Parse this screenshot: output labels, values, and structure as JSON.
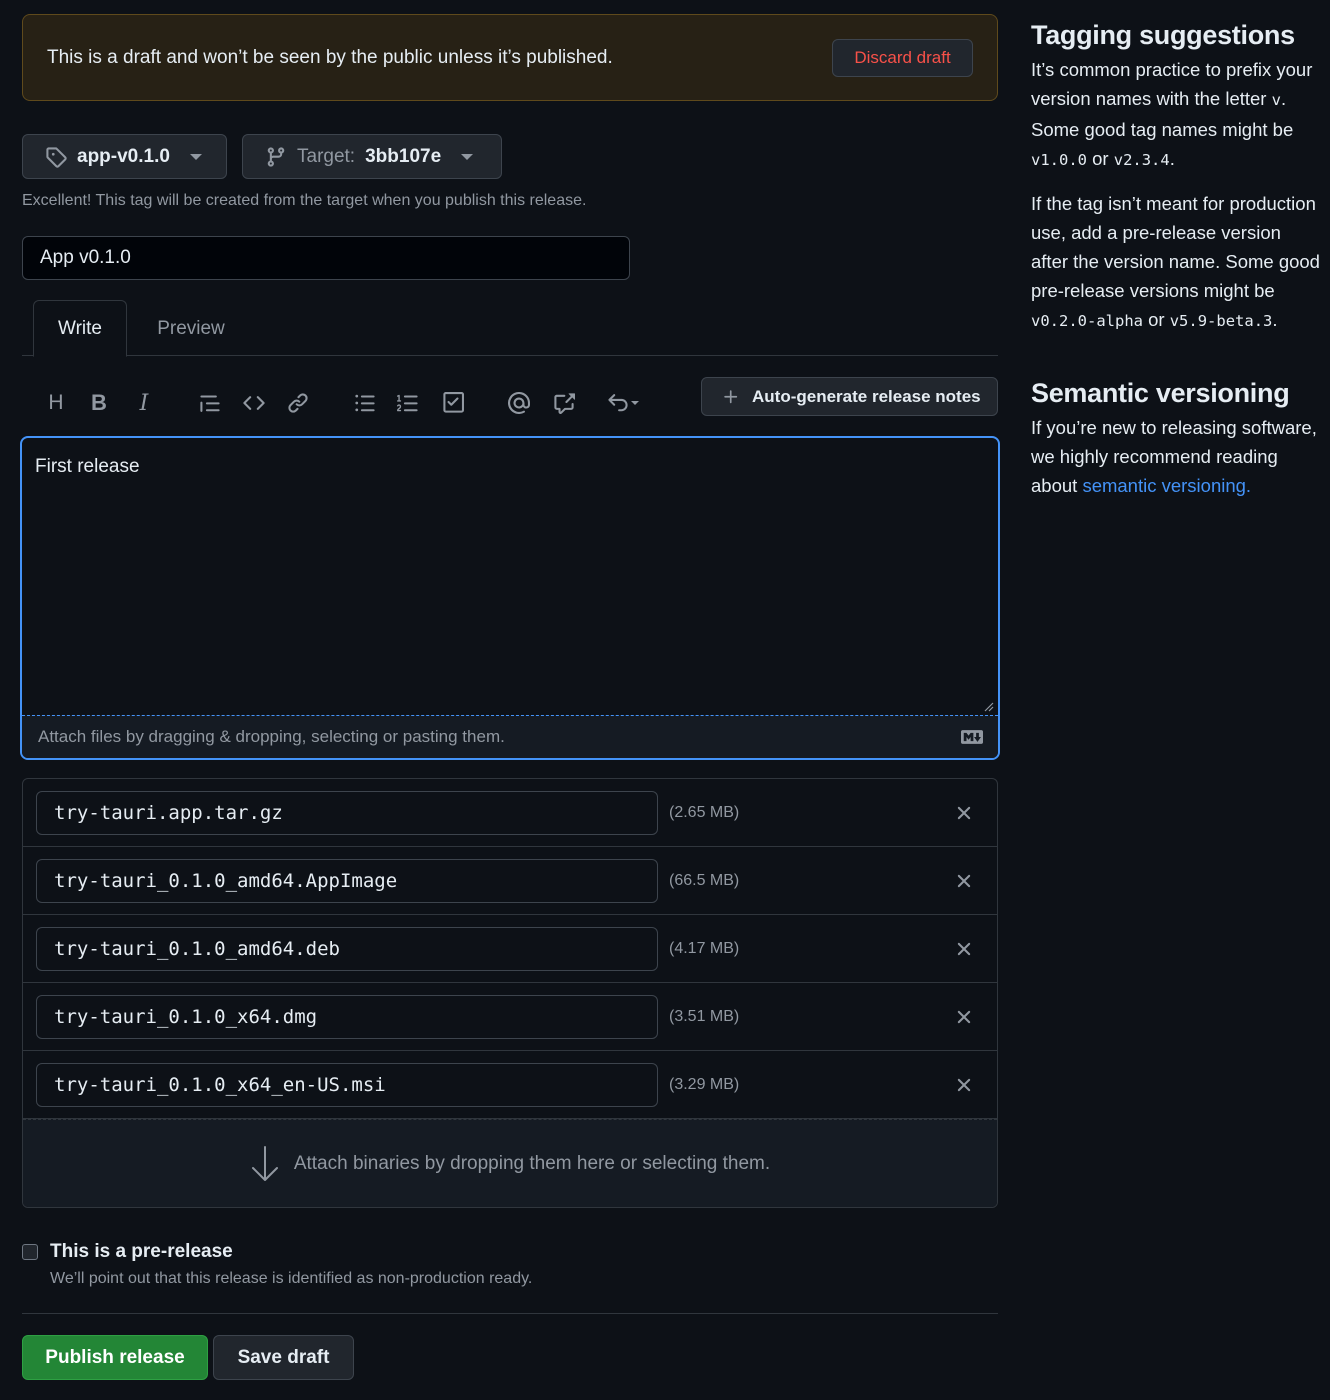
{
  "banner": {
    "text": "This is a draft and won’t be seen by the public unless it’s published.",
    "discard_label": "Discard draft"
  },
  "tag_picker": {
    "value": "app-v0.1.0",
    "icon": "tag-icon"
  },
  "target_picker": {
    "label": "Target:",
    "value": "3bb107e",
    "icon": "git-branch-icon"
  },
  "tag_hint": "Excellent! This tag will be created from the target when you publish this release.",
  "release_title": {
    "value": "App v0.1.0"
  },
  "tabs": {
    "write": "Write",
    "preview": "Preview"
  },
  "toolbar": {
    "heading": "H",
    "bold": "B",
    "italic": "I",
    "autogen_label": "Auto-generate release notes"
  },
  "editor": {
    "body": "First release",
    "attach_hint": "Attach files by dragging & dropping, selecting or pasting them."
  },
  "assets": [
    {
      "name": "try-tauri.app.tar.gz",
      "size": "(2.65 MB)"
    },
    {
      "name": "try-tauri_0.1.0_amd64.AppImage",
      "size": "(66.5 MB)"
    },
    {
      "name": "try-tauri_0.1.0_amd64.deb",
      "size": "(4.17 MB)"
    },
    {
      "name": "try-tauri_0.1.0_x64.dmg",
      "size": "(3.51 MB)"
    },
    {
      "name": "try-tauri_0.1.0_x64_en-US.msi",
      "size": "(3.29 MB)"
    }
  ],
  "dropzone_text": "Attach binaries by dropping them here or selecting them.",
  "prerelease": {
    "label": "This is a pre-release",
    "description": "We’ll point out that this release is identified as non-production ready.",
    "checked": false
  },
  "actions": {
    "publish": "Publish release",
    "save_draft": "Save draft"
  },
  "sidebar": {
    "tagging": {
      "title": "Tagging suggestions",
      "p1_a": "It’s common practice to prefix your version names with the letter ",
      "p1_code1": "v",
      "p1_b": ". Some good tag names might be ",
      "p1_code2": "v1.0.0",
      "p1_c": " or ",
      "p1_code3": "v2.3.4",
      "p1_d": ".",
      "p2_a": "If the tag isn’t meant for production use, add a pre-release version after the version name. Some good pre-release versions might be ",
      "p2_code1": "v0.2.0-alpha",
      "p2_b": " or ",
      "p2_code2": "v5.9-beta.3",
      "p2_c": "."
    },
    "semver": {
      "title": "Semantic versioning",
      "p_a": "If you’re new to releasing software, we highly recommend reading about ",
      "link": "semantic versioning."
    }
  },
  "colors": {
    "background": "#0d1117",
    "accent_blue": "#4493f8",
    "danger": "#f85149",
    "primary_green": "#238636",
    "banner_bg": "#272115"
  }
}
